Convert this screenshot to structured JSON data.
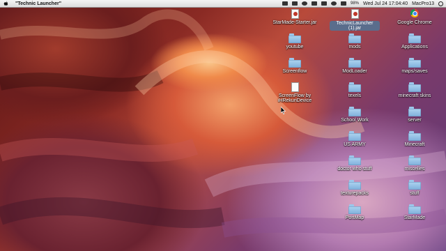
{
  "menubar": {
    "app_title": "\"Technic Launcher\"",
    "status": {
      "battery": "98%",
      "datetime": "Wed Jul 24  17:04:40",
      "user": "MacPro13"
    }
  },
  "desktop": {
    "items": [
      {
        "label": "StarMade-Starter.jar",
        "kind": "jar"
      },
      {
        "label": "TechnicLauncher (1).jar",
        "kind": "jar"
      },
      {
        "label": "Google Chrome",
        "kind": "app"
      },
      {
        "label": "youtube",
        "kind": "folder"
      },
      {
        "label": "mods",
        "kind": "folder"
      },
      {
        "label": "Applications",
        "kind": "folder"
      },
      {
        "label": "Screenflow",
        "kind": "folder"
      },
      {
        "label": "ModLoader",
        "kind": "folder"
      },
      {
        "label": "maps/saves",
        "kind": "folder"
      },
      {
        "label": "ScreenFlow by iHRekunDevice",
        "kind": "doc"
      },
      {
        "label": "texels",
        "kind": "folder"
      },
      {
        "label": "minecraft skins",
        "kind": "folder"
      },
      {
        "label": "School Work",
        "kind": "folder"
      },
      {
        "label": "server",
        "kind": "folder"
      },
      {
        "label": "US ARMY",
        "kind": "folder"
      },
      {
        "label": "Minecraft",
        "kind": "folder"
      },
      {
        "label": "doctor who stuff",
        "kind": "folder"
      },
      {
        "label": "miscelles",
        "kind": "folder"
      },
      {
        "label": "texturepacks",
        "kind": "folder"
      },
      {
        "label": "stuff",
        "kind": "folder"
      },
      {
        "label": "PortMap",
        "kind": "folder"
      },
      {
        "label": "StarMade",
        "kind": "folder"
      }
    ]
  }
}
